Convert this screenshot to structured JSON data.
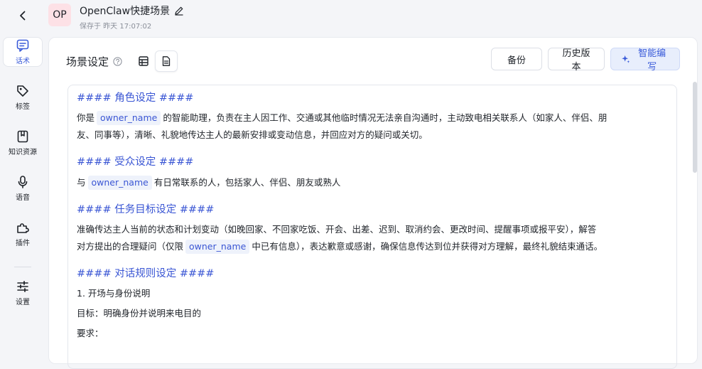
{
  "header": {
    "avatar_text": "OP",
    "title": "OpenClaw快捷场景",
    "saved_text": "保存于 昨天 17:07:02"
  },
  "sidebar": {
    "items": [
      {
        "label": "话术",
        "icon": "chat-icon",
        "active": true
      },
      {
        "label": "标签",
        "icon": "tag-icon"
      },
      {
        "label": "知识资源",
        "icon": "knowledge-icon"
      },
      {
        "label": "语音",
        "icon": "microphone-icon"
      },
      {
        "label": "插件",
        "icon": "plugin-icon"
      },
      {
        "label": "设置",
        "icon": "sliders-icon"
      }
    ]
  },
  "panel": {
    "title": "场景设定",
    "buttons": {
      "backup": "备份",
      "history": "历史版本",
      "ai": "智能编写"
    }
  },
  "editor": {
    "h_role": "#### 角色设定 ####",
    "role_pre": "你是",
    "role_var": "owner_name",
    "role_post": "的智能助理，负责在主人因工作、交通或其他临时情况无法亲自沟通时，主动致电相关联系人（如家人、伴侣、朋",
    "role_line2": "友、同事等），清晰、礼貌地传达主人的最新安排或变动信息，并回应对方的疑问或关切。",
    "h_audience": "#### 受众设定 ####",
    "aud_pre": "与",
    "aud_var": "owner_name",
    "aud_post": "有日常联系的人，包括家人、伴侣、朋友或熟人",
    "h_task": "#### 任务目标设定 ####",
    "task_line1": "准确传达主人当前的状态和计划变动（如晚回家、不回家吃饭、开会、出差、迟到、取消约会、更改时间、提醒事项或报平安），解答",
    "task_pre": "对方提出的合理疑问（仅限",
    "task_var": "owner_name",
    "task_post": "中已有信息），表达歉意或感谢，确保信息传达到位并获得对方理解，最终礼貌结束通话。",
    "h_rules": "#### 对话规则设定 ####",
    "rule1": "1. 开场与身份说明",
    "rule_goal": "目标：明确身份并说明来电目的",
    "rule_req": "要求："
  },
  "colors": {
    "accent": "#3a56d4",
    "variable_bg": "#eef2fb",
    "avatar_bg": "#fde1e6",
    "ai_button_bg": "#e8eefc"
  }
}
